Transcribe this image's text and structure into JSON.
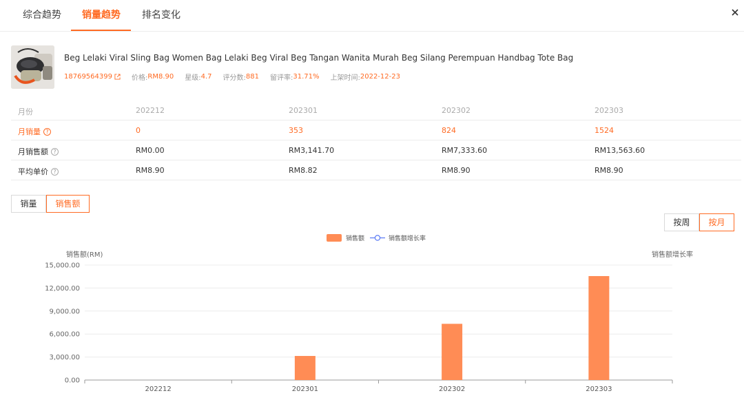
{
  "tabs": [
    {
      "label": "综合趋势",
      "active": false
    },
    {
      "label": "销量趋势",
      "active": true
    },
    {
      "label": "排名变化",
      "active": false
    }
  ],
  "close_label": "×",
  "product": {
    "title": "Beg Lelaki Viral Sling Bag Women Bag Lelaki Beg Viral Beg Tangan Wanita Murah Beg Silang Perempuan Handbag Tote Bag",
    "id": "18769564399",
    "price_label": "价格:",
    "price": "RM8.90",
    "rating_label": "星级:",
    "rating": "4.7",
    "reviews_label": "评分数:",
    "reviews": "881",
    "review_rate_label": "留评率:",
    "review_rate": "31.71%",
    "listed_label": "上架时间:",
    "listed": "2022-12-23"
  },
  "table": {
    "header": {
      "label": "月份",
      "values": [
        "202212",
        "202301",
        "202302",
        "202303"
      ]
    },
    "rows": [
      {
        "label": "月销量",
        "values": [
          "0",
          "353",
          "824",
          "1524"
        ],
        "highlight": true
      },
      {
        "label": "月销售额",
        "values": [
          "RM0.00",
          "RM3,141.70",
          "RM7,333.60",
          "RM13,563.60"
        ],
        "highlight": false
      },
      {
        "label": "平均单价",
        "values": [
          "RM8.90",
          "RM8.82",
          "RM8.90",
          "RM8.90"
        ],
        "highlight": false
      }
    ]
  },
  "metric_toggle": {
    "sales": "销量",
    "revenue": "销售额",
    "active": "revenue"
  },
  "period_toggle": {
    "week": "按周",
    "month": "按月",
    "active": "month"
  },
  "colors": {
    "accent": "#ff6a22",
    "bar": "#ff8c55",
    "line": "#5b7bf5"
  },
  "chart_data": {
    "type": "bar",
    "categories": [
      "202212",
      "202301",
      "202302",
      "202303"
    ],
    "series": [
      {
        "name": "销售额",
        "type": "bar",
        "values": [
          0,
          3141.7,
          7333.6,
          13563.6
        ]
      },
      {
        "name": "销售额增长率",
        "type": "line",
        "values": []
      }
    ],
    "ylabel": "销售额(RM)",
    "y2label": "销售额增长率",
    "ylim": [
      0,
      15000
    ],
    "yticks": [
      "0.00",
      "3,000.00",
      "6,000.00",
      "9,000.00",
      "12,000.00",
      "15,000.00"
    ],
    "grid": true,
    "legend": "top-center"
  }
}
